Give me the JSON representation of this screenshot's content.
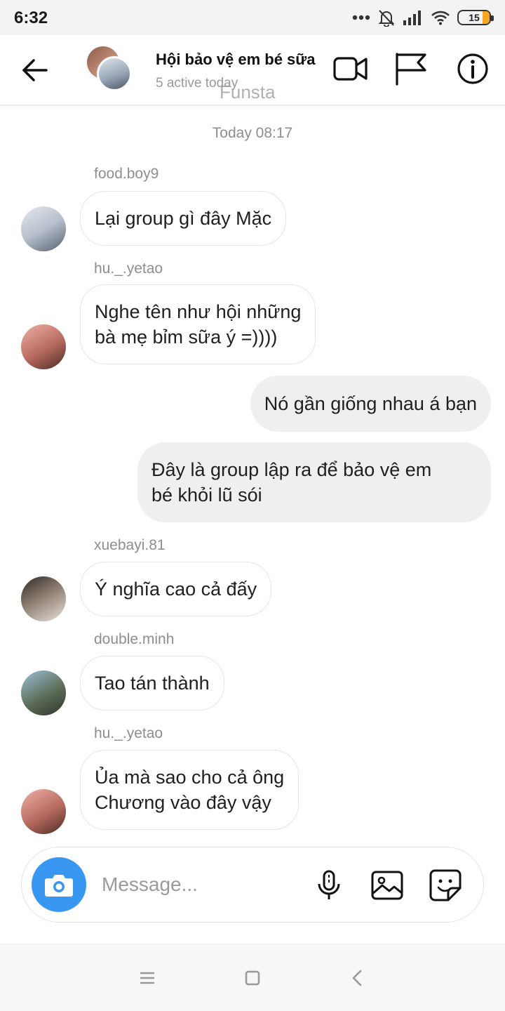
{
  "status_bar": {
    "time": "6:32",
    "battery": "15",
    "icons": [
      "dots-icon",
      "mute-icon",
      "signal-icon",
      "wifi-icon",
      "battery-icon"
    ]
  },
  "header": {
    "title": "Hội bảo vệ em bé sữa",
    "subtitle": "5 active today",
    "watermark": "Funsta",
    "icons": [
      "back-arrow-icon",
      "video-call-icon",
      "flag-icon",
      "info-icon"
    ]
  },
  "chat": {
    "timestamp": "Today 08:17",
    "messages": [
      {
        "sender": "food.boy9",
        "text": "Lại group gì đây Mặc",
        "direction": "incoming"
      },
      {
        "sender": "hu._.yetao",
        "text_lines": [
          "Nghe tên như hội những",
          "bà mẹ bỉm sữa ý =))))"
        ],
        "direction": "incoming"
      },
      {
        "text": "Nó gần giống nhau á bạn",
        "direction": "outgoing"
      },
      {
        "text_lines": [
          "Đây là group lập ra để bảo vệ em",
          "bé khỏi lũ sói"
        ],
        "direction": "outgoing"
      },
      {
        "sender": "xuebayi.81",
        "text": "Ý nghĩa cao cả đấy",
        "direction": "incoming"
      },
      {
        "sender": "double.minh",
        "text": "Tao tán thành",
        "direction": "incoming"
      },
      {
        "sender": "hu._.yetao",
        "text_lines": [
          "Ủa mà sao cho cả ông",
          "Chương vào đây vậy"
        ],
        "direction": "incoming"
      }
    ]
  },
  "composer": {
    "placeholder": "Message...",
    "icons": [
      "camera-icon",
      "microphone-icon",
      "gallery-icon",
      "sticker-icon"
    ]
  },
  "nav_bar": {
    "icons": [
      "menu-icon",
      "home-icon",
      "back-icon"
    ]
  },
  "colors": {
    "accent": "#3897f0",
    "outgoing_bubble": "#efefef",
    "incoming_border": "#e6e6e6",
    "muted_text": "#8e8e8e",
    "battery_fill": "#f5a623"
  }
}
